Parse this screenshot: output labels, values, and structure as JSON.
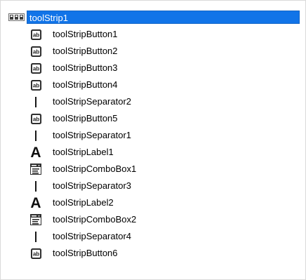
{
  "tree": {
    "root": {
      "label": "toolStrip1",
      "icon": "toolstrip-icon",
      "selected": true,
      "selection_color": "#1174e8"
    },
    "items": [
      {
        "label": "toolStripButton1",
        "icon": "button-icon"
      },
      {
        "label": "toolStripButton2",
        "icon": "button-icon"
      },
      {
        "label": "toolStripButton3",
        "icon": "button-icon"
      },
      {
        "label": "toolStripButton4",
        "icon": "button-icon"
      },
      {
        "label": "toolStripSeparator2",
        "icon": "separator-icon"
      },
      {
        "label": "toolStripButton5",
        "icon": "button-icon"
      },
      {
        "label": "toolStripSeparator1",
        "icon": "separator-icon"
      },
      {
        "label": "toolStripLabel1",
        "icon": "label-icon"
      },
      {
        "label": "toolStripComboBox1",
        "icon": "combobox-icon"
      },
      {
        "label": "toolStripSeparator3",
        "icon": "separator-icon"
      },
      {
        "label": "toolStripLabel2",
        "icon": "label-icon"
      },
      {
        "label": "toolStripComboBox2",
        "icon": "combobox-icon"
      },
      {
        "label": "toolStripSeparator4",
        "icon": "separator-icon"
      },
      {
        "label": "toolStripButton6",
        "icon": "button-icon"
      }
    ]
  }
}
